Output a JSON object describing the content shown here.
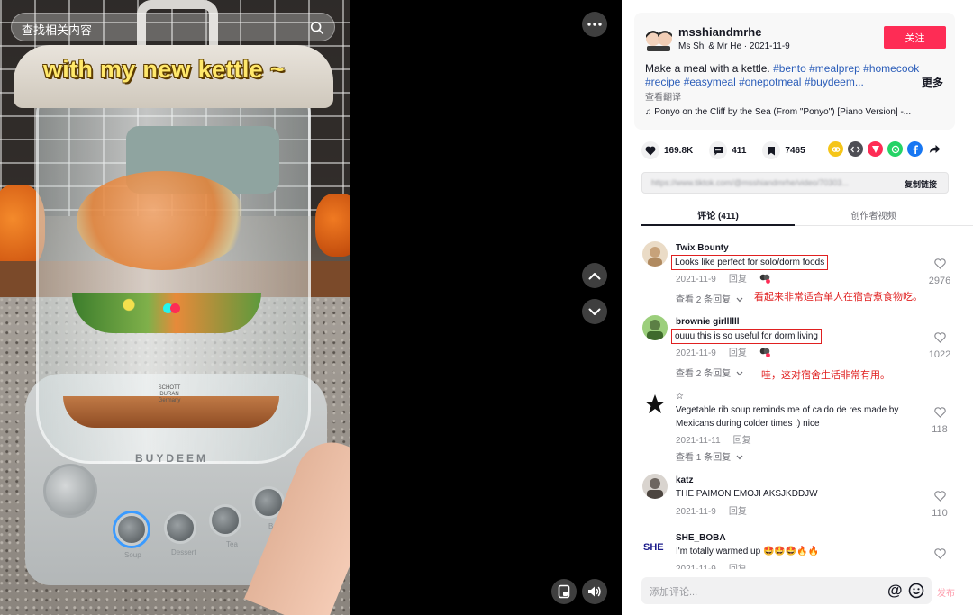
{
  "video": {
    "search_text": "查找相关内容",
    "overlay_caption": "with my new kettle ~",
    "device_brand": "BUYDEEM",
    "glass_brand": "SCHOTT DURAN Germany",
    "knob_labels": [
      "Soup",
      "Dessert",
      "Tea",
      "Boil"
    ]
  },
  "author": {
    "username": "msshiandmrhe",
    "display_line": "Ms Shi & Mr He · 2021-11-9",
    "follow_label": "关注"
  },
  "description": {
    "text": "Make a meal with a kettle. ",
    "tags": [
      "#bento",
      "#mealprep",
      "#homecook",
      "#recipe",
      "#easymeal",
      "#onepotmeal",
      "#buydeem..."
    ],
    "more_label": "更多",
    "translate_label": "查看翻译",
    "music": "Ponyo on the Cliff by the Sea (From \"Ponyo\") [Piano Version] -..."
  },
  "stats": {
    "likes": "169.8K",
    "comments": "411",
    "saves": "7465"
  },
  "share_icons": [
    {
      "name": "friends-share-icon",
      "color": "#f5c518"
    },
    {
      "name": "embed-icon",
      "color": "#4e4e55"
    },
    {
      "name": "send-icon",
      "color": "#fe2c55"
    },
    {
      "name": "whatsapp-icon",
      "color": "#25d366"
    },
    {
      "name": "facebook-icon",
      "color": "#1877f2"
    }
  ],
  "link": {
    "url": "https://www.tiktok.com/@msshiandmrhe/video/70303...",
    "copy_label": "复制链接"
  },
  "tabs": {
    "comments": "评论 (411)",
    "creator_videos": "创作者视频"
  },
  "comments": [
    {
      "user": "Twix Bounty",
      "text": "Looks like perfect for solo/dorm foods",
      "date": "2021-11-9",
      "reply_label": "回复",
      "replies_label": "查看 2 条回复",
      "likes": "2976",
      "annotation": "看起来非常适合单人在宿舍煮食物吃。"
    },
    {
      "user": "brownie girllllll",
      "text": "ouuu this is so useful for dorm living",
      "date": "2021-11-9",
      "reply_label": "回复",
      "replies_label": "查看 2 条回复",
      "likes": "1022",
      "annotation": "哇，这对宿舍生活非常有用。"
    },
    {
      "user": "☆",
      "text": "Vegetable rib soup reminds me of caldo de res made by Mexicans during colder times :) nice",
      "date": "2021-11-11",
      "reply_label": "回复",
      "replies_label": "查看 1 条回复",
      "likes": "118"
    },
    {
      "user": "katz",
      "text": "THE PAIMON EMOJI AKSJKDDJW",
      "date": "2021-11-9",
      "reply_label": "回复",
      "likes": "110"
    },
    {
      "user": "SHE_BOBA",
      "text": "I'm totally warmed up 🤩🤩🤩🔥🔥",
      "date": "2021-11-9",
      "reply_label": "回复",
      "likes": ""
    }
  ],
  "composer": {
    "placeholder": "添加评论...",
    "at_symbol": "@",
    "post_label": "发布"
  },
  "colors": {
    "brand_red": "#fe2c55",
    "annotation_red": "#e02020",
    "hashtag_blue": "#2b5db9"
  }
}
